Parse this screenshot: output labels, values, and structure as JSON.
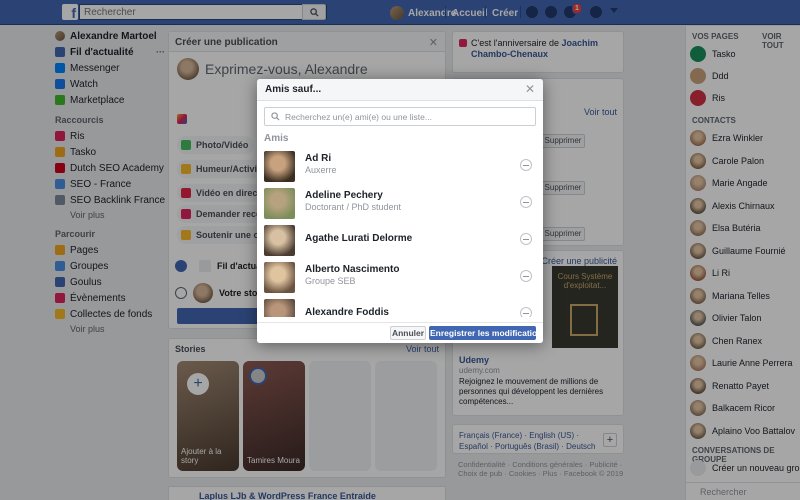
{
  "topbar": {
    "search_placeholder": "Rechercher",
    "profile_name": "Alexandre",
    "home_label": "Accueil",
    "create_label": "Créer",
    "notification_count": "1"
  },
  "left_nav": {
    "profile": "Alexandre Martoel",
    "items": [
      {
        "label": "Fil d'actualité",
        "color": "#4267b2",
        "count": "···"
      },
      {
        "label": "Messenger",
        "color": "#0084ff",
        "count": ""
      },
      {
        "label": "Watch",
        "color": "#1877f2",
        "count": ""
      },
      {
        "label": "Marketplace",
        "color": "#42b72a",
        "count": ""
      }
    ],
    "shortcuts_title": "Raccourcis",
    "shortcuts": [
      {
        "label": "Ris",
        "color": "#e0245e"
      },
      {
        "label": "Tasko",
        "color": "#f5a623"
      },
      {
        "label": "Dutch SEO Academy",
        "color": "#d0021b"
      },
      {
        "label": "SEO - France",
        "color": "#4a90e2"
      },
      {
        "label": "SEO Backlink France",
        "color": "#7b8a9a"
      }
    ],
    "shortcuts_more": "Voir plus",
    "explore_title": "Parcourir",
    "explore": [
      {
        "label": "Pages",
        "color": "#f5a623"
      },
      {
        "label": "Groupes",
        "color": "#4a90e2"
      },
      {
        "label": "Goulus",
        "color": "#4267b2"
      },
      {
        "label": "Évènements",
        "color": "#e0245e"
      },
      {
        "label": "Collectes de fonds",
        "color": "#f7b928"
      }
    ],
    "explore_more": "Voir plus"
  },
  "create_post": {
    "title": "Créer une publication",
    "placeholder": "Exprimez-vous, Alexandre",
    "actions": [
      {
        "label": "Photo/Vidéo",
        "color": "#45bd62"
      },
      {
        "label": "Humeur/Activité",
        "color": "#f7b928"
      },
      {
        "label": "Vidéo en direct",
        "color": "#e42645"
      },
      {
        "label": "Demander recomm...",
        "color": "#e0245e"
      },
      {
        "label": "Soutenir une organ...",
        "color": "#f7b928"
      }
    ],
    "feed_label": "Fil d'actualit...",
    "story_label": "Votre story"
  },
  "stories": {
    "title": "Stories",
    "see_all": "Voir tout",
    "items": [
      {
        "label": "Ajouter à la story"
      },
      {
        "label": "Tamires Moura"
      }
    ]
  },
  "bottom_post": "Laplus LJb & WordPress France Entraide",
  "middle": {
    "birthday": "C'est l'anniversaire de",
    "birthday_names": "Joachim Chambo-Chenaux",
    "see_all": "Voir tout",
    "delete_label": "Supprimer",
    "create_ad": "Créer une publicité",
    "ad_image_text": "Cours Système d'exploitat...",
    "ad_title": "Udemy",
    "ad_url": "udemy.com",
    "ad_desc": "Rejoignez le mouvement de millions de personnes qui développent les dernières compétences...",
    "languages": "Français (France) · English (US) · Español · Português (Brasil) · Deutsch",
    "footer": "Confidentialité · Conditions générales · Publicité · Choix de pub · Cookies · Plus · Facebook © 2019"
  },
  "right_bar": {
    "pages_title": "VOS PAGES",
    "see_all": "VOIR TOUT",
    "pages": [
      {
        "label": "Tasko",
        "color": "#1a8f5c"
      },
      {
        "label": "Ddd",
        "color": "#c9a27a"
      },
      {
        "label": "Ris",
        "color": "#d03045"
      }
    ],
    "contacts_title": "CONTACTS",
    "contacts": [
      {
        "label": "Ezra Winkler",
        "color": "#a87a5c"
      },
      {
        "label": "Carole Palon",
        "color": "#8c6b4e"
      },
      {
        "label": "Marie Angade",
        "color": "#b39079"
      },
      {
        "label": "Alexis Chirnaux",
        "color": "#6b5a48"
      },
      {
        "label": "Elsa Butéria",
        "color": "#9b7b62"
      },
      {
        "label": "Guillaume Fournié",
        "color": "#7a6450"
      },
      {
        "label": "Li Ri",
        "color": "#a0634a"
      },
      {
        "label": "Mariana Telles",
        "color": "#8a6e58"
      },
      {
        "label": "Olivier Talon",
        "color": "#5f5f5f"
      },
      {
        "label": "Chen Ranex",
        "color": "#7e6a56"
      },
      {
        "label": "Laurie Anne Perrera",
        "color": "#b0866a"
      },
      {
        "label": "Renatto Payet",
        "color": "#6c5847"
      },
      {
        "label": "Balkacem Ricor",
        "color": "#8f7a63"
      },
      {
        "label": "Aplaino Voo Battalov",
        "color": "#7d6957"
      }
    ],
    "groups_title": "CONVERSATIONS DE GROUPE",
    "new_group": "Créer un nouveau groupe",
    "search": "Rechercher"
  },
  "modal": {
    "title": "Amis sauf...",
    "search_placeholder": "Recherchez un(e) ami(e) ou une liste...",
    "section_title": "Amis",
    "friends": [
      {
        "name": "Ad Ri",
        "sub": "Auxerre",
        "colors": [
          "#3a2e22",
          "#c8a27e"
        ]
      },
      {
        "name": "Adeline Pechery",
        "sub": "Doctorant / PhD student",
        "colors": [
          "#7b8d5a",
          "#b6a27e"
        ]
      },
      {
        "name": "Agathe Lurati Delorme",
        "sub": "",
        "colors": [
          "#4a3b30",
          "#d8c1a2"
        ]
      },
      {
        "name": "Alberto Nascimento",
        "sub": "Groupe SEB",
        "colors": [
          "#6a5340",
          "#e0c4a0"
        ]
      },
      {
        "name": "Alexandre Foddis",
        "sub": "",
        "colors": [
          "#5a4a3e",
          "#b9957a"
        ]
      }
    ],
    "cancel_label": "Annuler",
    "save_label": "Enregistrer les modifications"
  }
}
